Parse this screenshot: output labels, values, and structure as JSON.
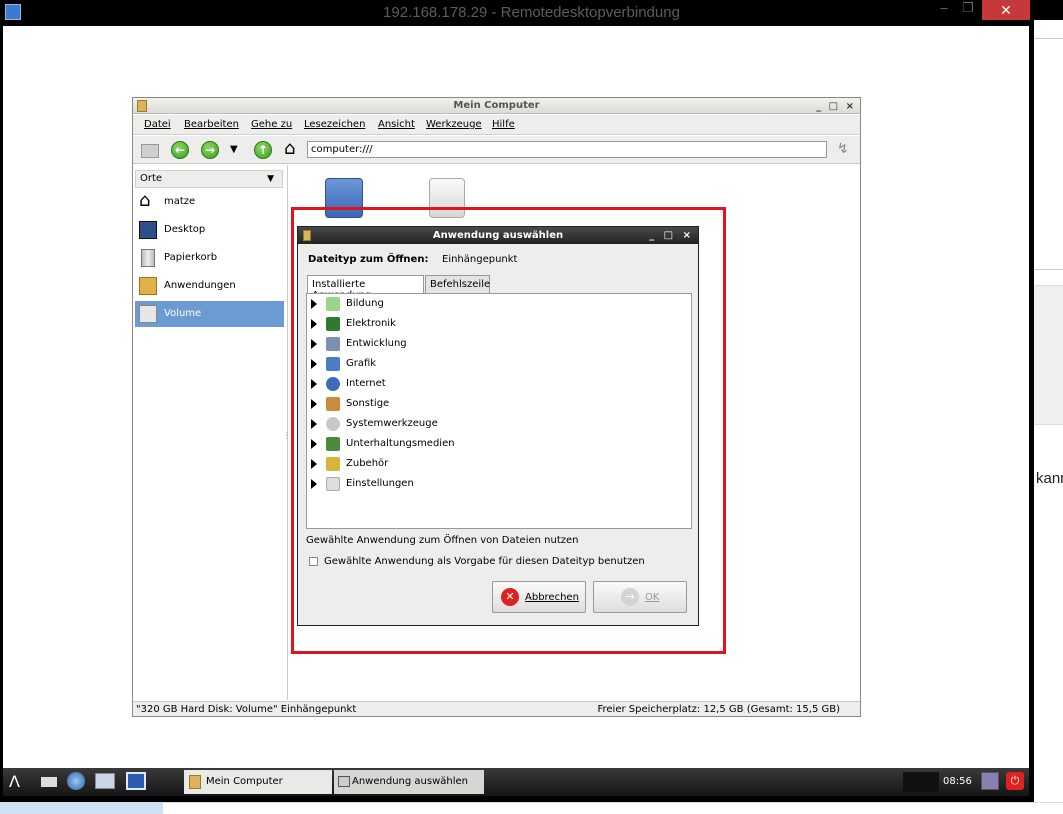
{
  "rdp": {
    "title": "192.168.178.29 - Remotedesktopverbindung",
    "minimize": "–",
    "restore": "❐",
    "close": "✕"
  },
  "host": {
    "partial_text": "kann"
  },
  "filemanager": {
    "title": "Mein Computer",
    "controls": "_ □ ×",
    "menu": [
      "Datei",
      "Bearbeiten",
      "Gehe zu",
      "Lesezeichen",
      "Ansicht",
      "Werkzeuge",
      "Hilfe"
    ],
    "address": "computer:///",
    "sidebar_header": "Orte",
    "sidebar_items": [
      "matze",
      "Desktop",
      "Papierkorb",
      "Anwendungen",
      "Volume"
    ],
    "status_left": "\"320 GB Hard Disk: Volume\" Einhängepunkt",
    "status_right": "Freier Speicherplatz: 12,5 GB (Gesamt: 15,5 GB)"
  },
  "dialog": {
    "title": "Anwendung auswählen",
    "controls": "_ □ ×",
    "filetype_label": "Dateityp zum Öffnen:",
    "filetype_value": "Einhängepunkt",
    "tabs": [
      "Installierte Anwendung",
      "Befehlszeile"
    ],
    "categories": [
      "Bildung",
      "Elektronik",
      "Entwicklung",
      "Grafik",
      "Internet",
      "Sonstige",
      "Systemwerkzeuge",
      "Unterhaltungsmedien",
      "Zubehör",
      "Einstellungen"
    ],
    "use_app_text": "Gewählte Anwendung zum Öffnen von Dateien nutzen",
    "default_checkbox": "Gewählte Anwendung als Vorgabe für diesen Dateityp benutzen",
    "cancel": "Abbrechen",
    "ok": "OK"
  },
  "taskbar": {
    "tasks": [
      "Mein Computer",
      "Anwendung auswählen"
    ],
    "clock": "08:56"
  },
  "colors": {
    "highlight": "#e0141e",
    "selection": "#6b9bd2",
    "rdp_close": "#c7383b"
  }
}
